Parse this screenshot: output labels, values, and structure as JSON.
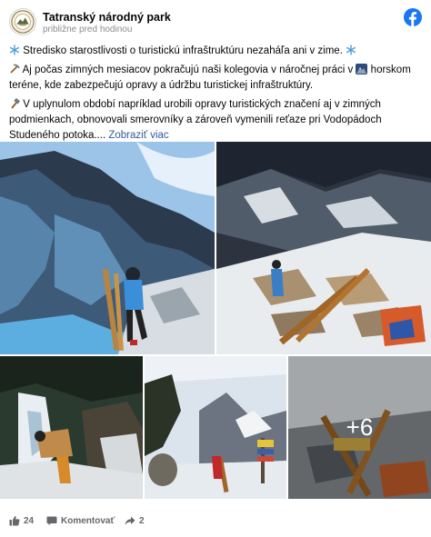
{
  "header": {
    "page_name": "Tatranský národný park",
    "timestamp": "približne pred hodinou",
    "avatar_icon": "tanap-emblem-icon",
    "brand_icon": "facebook-logo-icon",
    "brand_color": "#1877f2"
  },
  "post": {
    "line1": "Stredisko starostlivosti o turistickú infraštruktúru nezaháľa ani v zime.",
    "line2_part1": "Aj počas zimných mesiacov pokračujú naši kolegovia v náročnej práci v",
    "line2_part2": "horskom teréne, kde zabezpečujú opravy a údržbu turistickej infraštruktúry.",
    "line3": "V uplynulom období napríklad urobili opravy turistických značení aj v zimných podmienkach, obnovovali smerovníky a zároveň vymenili reťaze pri Vodopádoch Studeného potoka....",
    "see_more": "Zobraziť viac",
    "icons": [
      "snowflake-icon",
      "pick-icon",
      "mountain-icon",
      "hammer-icon",
      "snowflake-icon"
    ]
  },
  "photos": {
    "more_count": "+6"
  },
  "footer": {
    "likes": "24",
    "comment_label": "Komentovať",
    "shares": "2",
    "text_color": "#65676b"
  }
}
